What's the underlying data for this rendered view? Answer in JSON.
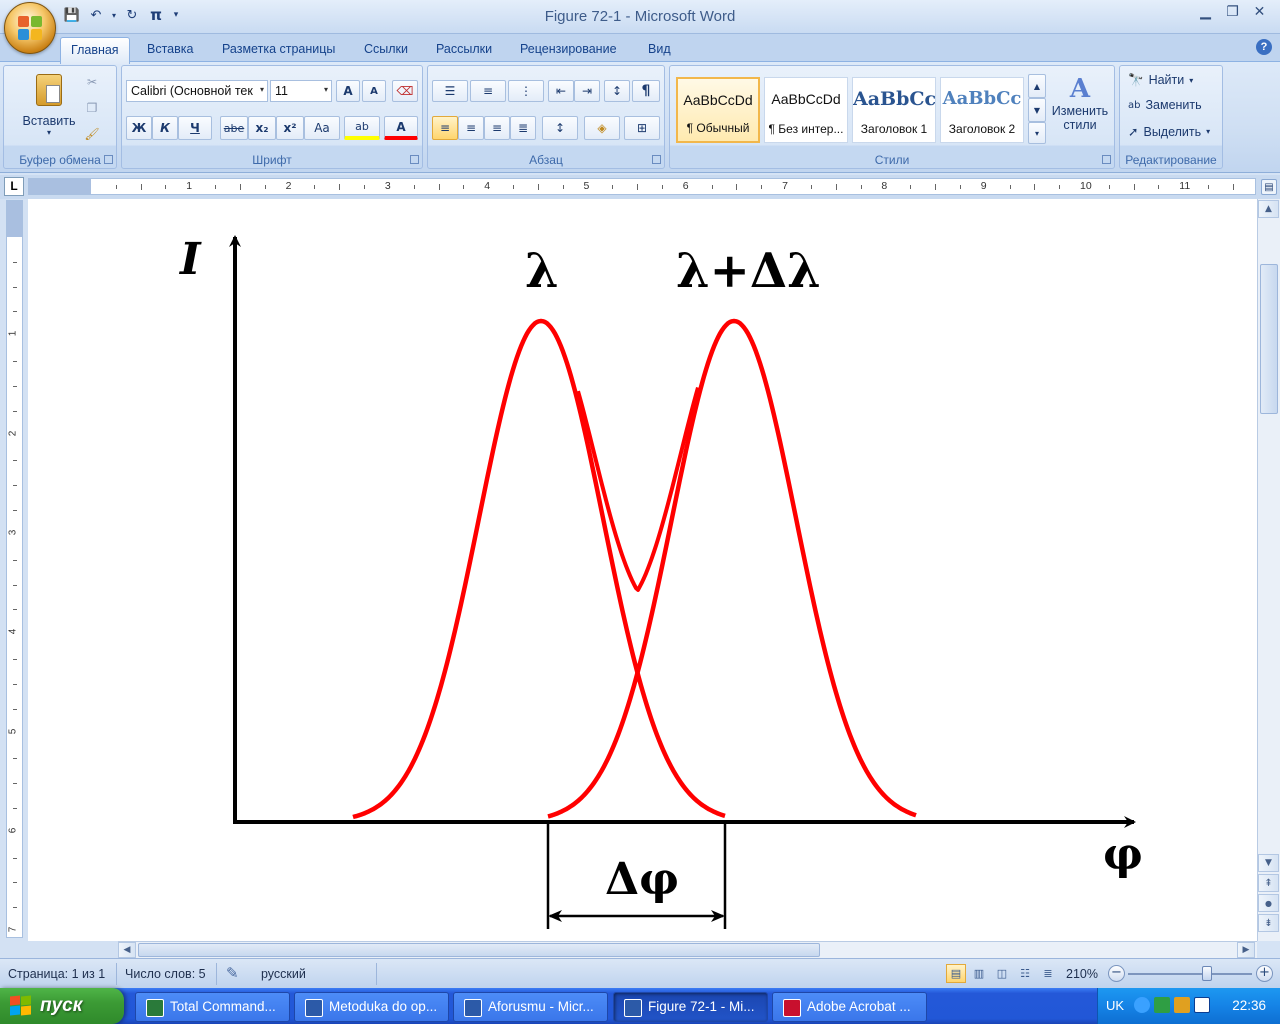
{
  "window": {
    "title": "Figure 72-1 - Microsoft Word",
    "controls": [
      "minimize-icon",
      "restore-icon",
      "close-icon"
    ]
  },
  "quick_access": {
    "icons": [
      "save-icon",
      "undo-icon",
      "redo-icon",
      "pi-icon",
      "customize-icon"
    ],
    "pi_label": "π"
  },
  "tabs": [
    {
      "label": "Главная",
      "active": true
    },
    {
      "label": "Вставка"
    },
    {
      "label": "Разметка страницы"
    },
    {
      "label": "Ссылки"
    },
    {
      "label": "Рассылки"
    },
    {
      "label": "Рецензирование"
    },
    {
      "label": "Вид"
    }
  ],
  "ribbon": {
    "clipboard": {
      "label": "Буфер обмена",
      "paste": "Вставить"
    },
    "font": {
      "label": "Шрифт",
      "font_name": "Calibri (Основной тек",
      "font_size": "11",
      "grow": "A",
      "shrink": "A",
      "bold": "Ж",
      "italic": "К",
      "underline": "Ч",
      "strike": "abe",
      "subscript": "x₂",
      "superscript": "x²",
      "case": "Aa",
      "highlight": "ab",
      "color": "A"
    },
    "paragraph": {
      "label": "Абзац",
      "pilcrow": "¶"
    },
    "styles": {
      "label": "Стили",
      "items": [
        {
          "sample": "AaBbCcDd",
          "name": "¶ Обычный",
          "selected": true
        },
        {
          "sample": "AaBbCcDd",
          "name": "¶ Без интер..."
        },
        {
          "sample": "AaBbCc",
          "name": "Заголовок 1"
        },
        {
          "sample": "AaBbCc",
          "name": "Заголовок 2"
        }
      ],
      "change_styles_line1": "Изменить",
      "change_styles_line2": "стили"
    },
    "editing": {
      "label": "Редактирование",
      "find": "Найти",
      "replace": "Заменить",
      "select": "Выделить"
    }
  },
  "ruler": {
    "corner": "L",
    "h_numbers": [
      "1",
      "2",
      "3",
      "4",
      "5",
      "6",
      "7",
      "8",
      "9",
      "10",
      "11"
    ],
    "v_numbers": [
      "1",
      "2",
      "3",
      "4",
      "5",
      "6",
      "7"
    ]
  },
  "figure": {
    "y_axis_label": "I",
    "peak1_label": "λ",
    "peak2_label": "λ+Δλ",
    "x_axis_label": "φ",
    "separation_label": "Δφ",
    "curve_color": "#ff0000"
  },
  "status": {
    "page": "Страница: 1 из 1",
    "words": "Число слов: 5",
    "language": "русский",
    "zoom": "210%"
  },
  "taskbar": {
    "start": "пуск",
    "tasks": [
      {
        "label": "Total Command...",
        "icon": "total-commander-icon"
      },
      {
        "label": "Metoduka do op...",
        "icon": "word-doc-icon"
      },
      {
        "label": "Aforusmu - Micr...",
        "icon": "word-doc-icon"
      },
      {
        "label": "Figure 72-1 - Mi...",
        "icon": "word-doc-icon",
        "active": true
      },
      {
        "label": "Adobe Acrobat ...",
        "icon": "acrobat-icon"
      }
    ],
    "language": "UK",
    "clock": "22:36"
  }
}
